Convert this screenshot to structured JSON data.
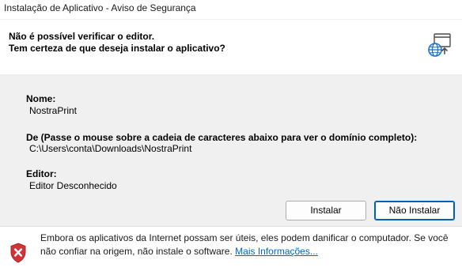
{
  "window": {
    "title": "Instalação de Aplicativo - Aviso de Segurança"
  },
  "header": {
    "line1": "Não é possível verificar o editor.",
    "line2": "Tem certeza de que deseja instalar o aplicativo?",
    "icon": "globe-install-icon"
  },
  "fields": {
    "name_label": "Nome:",
    "name_value": "NostraPrint",
    "from_label": "De (Passe o mouse sobre a cadeia de caracteres abaixo para ver o domínio completo):",
    "from_value": "C:\\Users\\conta\\Downloads\\NostraPrint",
    "publisher_label": "Editor:",
    "publisher_value": "Editor Desconhecido"
  },
  "buttons": {
    "install": "Instalar",
    "cancel": "Não Instalar"
  },
  "footer": {
    "icon": "warning-shield-icon",
    "line1": "Embora os aplicativos da Internet possam ser úteis, eles podem danificar o computador. Se você",
    "line2": "não confiar na origem, não instale o software.",
    "link": "Mais Informações..."
  },
  "colors": {
    "accent": "#005fb8",
    "link": "#0066cc",
    "shield_red": "#d13438"
  }
}
